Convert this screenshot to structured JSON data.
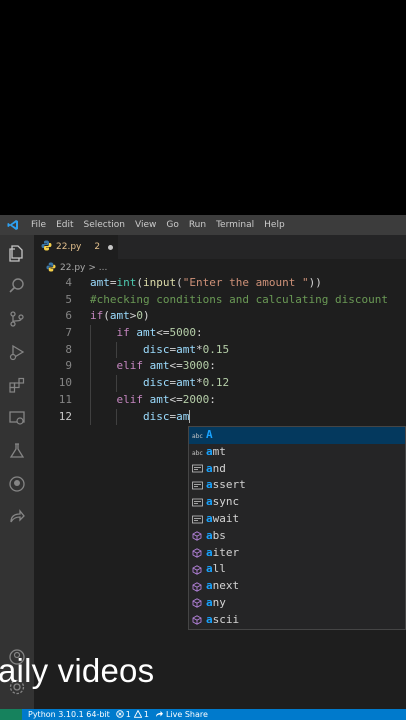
{
  "menubar": {
    "items": [
      "File",
      "Edit",
      "Selection",
      "View",
      "Go",
      "Run",
      "Terminal",
      "Help"
    ]
  },
  "tab": {
    "filename": "22.py",
    "problems": "2"
  },
  "breadcrumb": {
    "file": "22.py",
    "sep": "> ..."
  },
  "editor": {
    "lines": [
      {
        "num": "4",
        "code": "amt=int(input(\"Enter the amount \"))"
      },
      {
        "num": "5",
        "code": "#checking conditions and calculating discount"
      },
      {
        "num": "6",
        "code": "if(amt>0)"
      },
      {
        "num": "7",
        "code": "    if amt<=5000:"
      },
      {
        "num": "8",
        "code": "        disc=amt*0.15"
      },
      {
        "num": "9",
        "code": "    elif amt<=3000:"
      },
      {
        "num": "10",
        "code": "        disc=amt*0.12"
      },
      {
        "num": "11",
        "code": "    elif amt<=2000:"
      },
      {
        "num": "12",
        "code": "        disc=am"
      }
    ]
  },
  "suggestions": [
    {
      "label": "A",
      "icon": "abc-text-icon",
      "selected": true
    },
    {
      "label": "amt",
      "icon": "abc-text-icon"
    },
    {
      "label": "and",
      "icon": "keyword-icon"
    },
    {
      "label": "assert",
      "icon": "keyword-icon"
    },
    {
      "label": "async",
      "icon": "keyword-icon"
    },
    {
      "label": "await",
      "icon": "keyword-icon"
    },
    {
      "label": "abs",
      "icon": "method-cube-icon"
    },
    {
      "label": "aiter",
      "icon": "method-cube-icon"
    },
    {
      "label": "all",
      "icon": "method-cube-icon"
    },
    {
      "label": "anext",
      "icon": "method-cube-icon"
    },
    {
      "label": "any",
      "icon": "method-cube-icon"
    },
    {
      "label": "ascii",
      "icon": "method-cube-icon"
    }
  ],
  "overlay": {
    "text": "aily videos"
  },
  "statusbar": {
    "python": "Python 3.10.1 64-bit",
    "errors": "1",
    "warnings": "1",
    "liveshare": "Live Share"
  },
  "colors": {
    "accent": "#007acc",
    "menubar": "#3c3c3c",
    "editor_bg": "#1e1e1e",
    "suggest_selected": "#04395e",
    "match_highlight": "#18a3ff"
  }
}
